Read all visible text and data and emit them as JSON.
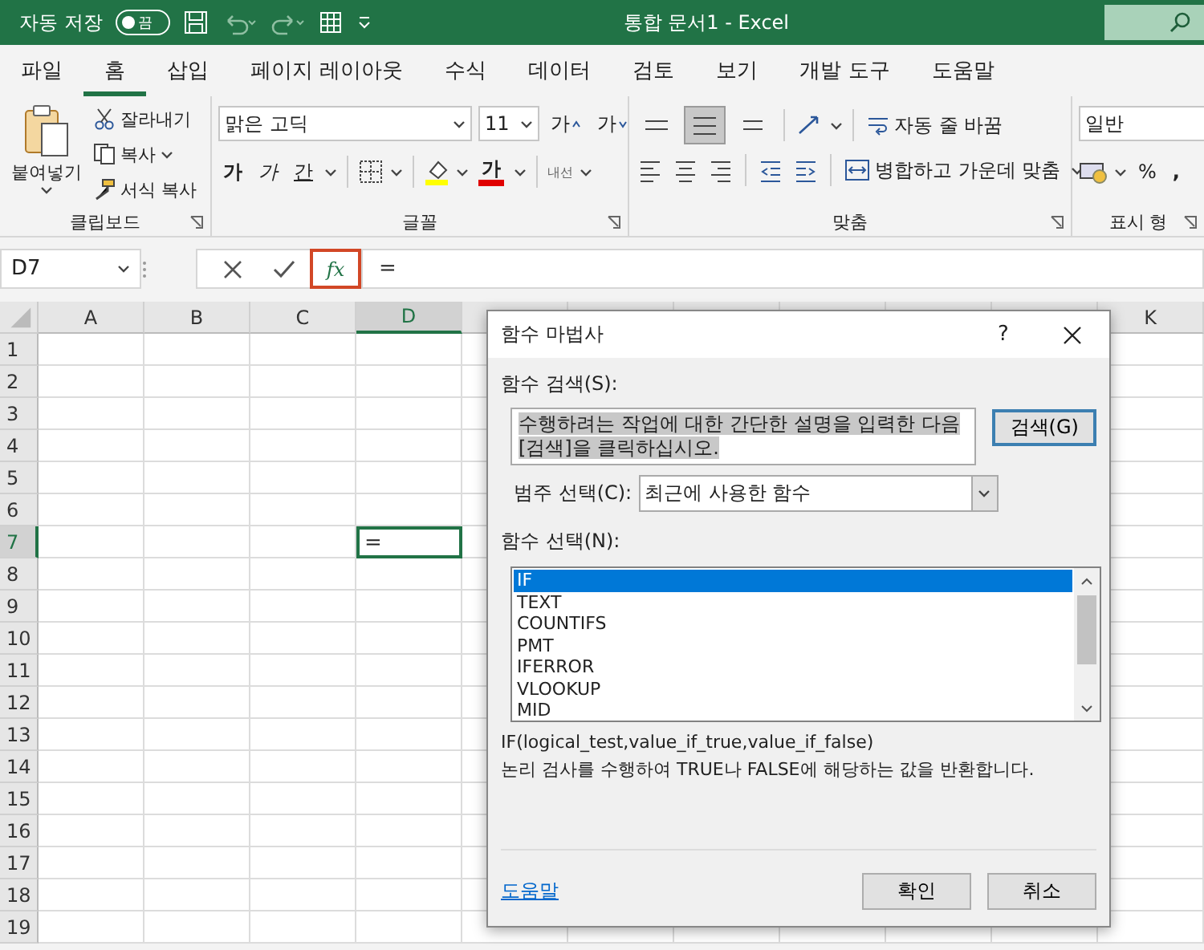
{
  "title_bar": {
    "autosave_label": "자동 저장",
    "autosave_toggle": {
      "label": "끔",
      "on": false
    },
    "title": "통합 문서1  -  Excel"
  },
  "ribbon_tabs": [
    {
      "label": "파일",
      "selected": false
    },
    {
      "label": "홈",
      "selected": true
    },
    {
      "label": "삽입",
      "selected": false
    },
    {
      "label": "페이지 레이아웃",
      "selected": false
    },
    {
      "label": "수식",
      "selected": false
    },
    {
      "label": "데이터",
      "selected": false
    },
    {
      "label": "검토",
      "selected": false
    },
    {
      "label": "보기",
      "selected": false
    },
    {
      "label": "개발 도구",
      "selected": false
    },
    {
      "label": "도움말",
      "selected": false
    }
  ],
  "ribbon": {
    "clipboard": {
      "paste": "붙여넣기",
      "cut": "잘라내기",
      "copy": "복사",
      "format_painter": "서식 복사",
      "group_label": "클립보드"
    },
    "font": {
      "font_name": "맑은 고딕",
      "font_size": "11",
      "grow": "가",
      "shrink": "가",
      "bold": "가",
      "italic": "가",
      "underline": "간",
      "font_color": "가",
      "phonetic": "내선",
      "group_label": "글꼴"
    },
    "alignment": {
      "vertical_align_buttons": [
        {
          "kind": "top",
          "selected": false
        },
        {
          "kind": "middle",
          "selected": true
        },
        {
          "kind": "bottom",
          "selected": false
        }
      ],
      "wrap_text": "자동 줄 바꿈",
      "merge_center": "병합하고 가운데 맞춤",
      "group_label": "맞춤"
    },
    "number": {
      "format": "일반",
      "percent": "%",
      "comma": ",",
      "group_label": "표시 형"
    }
  },
  "formula_bar": {
    "name_box": "D7",
    "insert_function": {
      "label": "fx",
      "highlighted": true
    },
    "formula": "="
  },
  "sheet": {
    "column_headers": [
      {
        "label": "A",
        "selected": false
      },
      {
        "label": "B",
        "selected": false
      },
      {
        "label": "C",
        "selected": false
      },
      {
        "label": "D",
        "selected": true
      },
      {
        "label": "K",
        "selected": false
      }
    ],
    "rows": [
      {
        "label": "1",
        "selected": false
      },
      {
        "label": "2",
        "selected": false
      },
      {
        "label": "3",
        "selected": false
      },
      {
        "label": "4",
        "selected": false
      },
      {
        "label": "5",
        "selected": false
      },
      {
        "label": "6",
        "selected": false
      },
      {
        "label": "7",
        "selected": true
      },
      {
        "label": "8",
        "selected": false
      },
      {
        "label": "9",
        "selected": false
      },
      {
        "label": "10",
        "selected": false
      },
      {
        "label": "11",
        "selected": false
      },
      {
        "label": "12",
        "selected": false
      },
      {
        "label": "13",
        "selected": false
      },
      {
        "label": "14",
        "selected": false
      },
      {
        "label": "15",
        "selected": false
      },
      {
        "label": "16",
        "selected": false
      },
      {
        "label": "17",
        "selected": false
      },
      {
        "label": "18",
        "selected": false
      },
      {
        "label": "19",
        "selected": false
      }
    ],
    "active_cell": {
      "value": "="
    }
  },
  "dialog": {
    "title": "함수 마법사",
    "help_glyph": "?",
    "search_label": "함수 검색(S):",
    "search_text": "수행하려는 작업에 대한 간단한 설명을 입력한 다음 [검색]을 클릭하십시오.",
    "search_text_selected": true,
    "search_button": "검색(G)",
    "category_label": "범주 선택(C):",
    "category_value": "최근에 사용한 함수",
    "function_label": "함수 선택(N):",
    "functions": [
      {
        "name": "IF",
        "selected": true
      },
      {
        "name": "TEXT",
        "selected": false
      },
      {
        "name": "COUNTIFS",
        "selected": false
      },
      {
        "name": "PMT",
        "selected": false
      },
      {
        "name": "IFERROR",
        "selected": false
      },
      {
        "name": "VLOOKUP",
        "selected": false
      },
      {
        "name": "MID",
        "selected": false
      }
    ],
    "syntax": "IF(logical_test,value_if_true,value_if_false)",
    "description": "논리 검사를 수행하여 TRUE나 FALSE에 해당하는 값을 반환합니다.",
    "help_link": "도움말",
    "ok_button": "확인",
    "cancel_button": "취소"
  }
}
